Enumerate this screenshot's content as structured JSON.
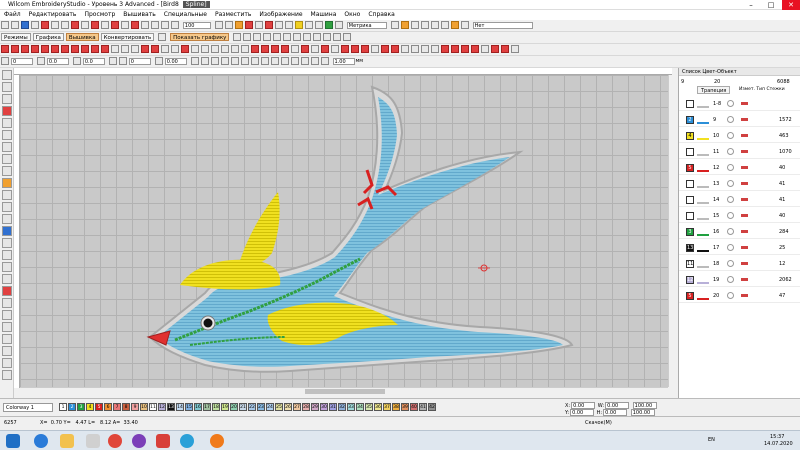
{
  "app": {
    "title": "Wilcom EmbroideryStudio - Уровень 3 Advanced - [Bird8",
    "title_badge": "Spline]"
  },
  "menu": [
    "Файл",
    "Редактировать",
    "Просмотр",
    "Вышивать",
    "Специальные",
    "Разместить",
    "Изображение",
    "Машина",
    "Окно",
    "Справка"
  ],
  "toolbar2": {
    "modes": [
      "Режимы",
      "Графика",
      "Вышивка",
      "Конвертировать"
    ],
    "show_graphics": "Показать графику",
    "zoom": "100",
    "units": "Метрика",
    "none": "Нет"
  },
  "toolbar3": {
    "f1": "0",
    "f2": "0.0",
    "f3": "0.0",
    "f4": "0",
    "f5": "0.00",
    "f6": "1.00",
    "unit": "мм"
  },
  "panel": {
    "title": "Список Цвет-Объект",
    "tab": "Трапеция",
    "hdr_left": "9",
    "hdr_mid": "20",
    "hdr_count": "6088",
    "col_labels": "Измет. Тип   Стежки",
    "rows": [
      {
        "sw": "",
        "num": "1-8",
        "count": "",
        "color": "#ffffff"
      },
      {
        "sw": "2",
        "num": "9",
        "count": "1572",
        "color": "#2b8fd8"
      },
      {
        "sw": "4",
        "num": "10",
        "count": "463",
        "color": "#f2e020"
      },
      {
        "sw": "",
        "num": "11",
        "count": "1070",
        "color": "#ffffff"
      },
      {
        "sw": "5",
        "num": "12",
        "count": "40",
        "color": "#d82020"
      },
      {
        "sw": "",
        "num": "13",
        "count": "41",
        "color": "#ffffff"
      },
      {
        "sw": "",
        "num": "14",
        "count": "41",
        "color": "#ffffff"
      },
      {
        "sw": "",
        "num": "15",
        "count": "40",
        "color": "#ffffff"
      },
      {
        "sw": "3",
        "num": "16",
        "count": "284",
        "color": "#20a040"
      },
      {
        "sw": "13",
        "num": "17",
        "count": "25",
        "color": "#111111"
      },
      {
        "sw": "11",
        "num": "18",
        "count": "12",
        "color": "#ffffff"
      },
      {
        "sw": "12",
        "num": "19",
        "count": "2062",
        "color": "#b8b0d8"
      },
      {
        "sw": "5",
        "num": "20",
        "count": "47",
        "color": "#d82020"
      }
    ]
  },
  "colorbar": {
    "colorway": "Colorway 1",
    "swatches": [
      {
        "n": "1",
        "c": "#ffffff"
      },
      {
        "n": "2",
        "c": "#2b8fd8"
      },
      {
        "n": "3",
        "c": "#20a040"
      },
      {
        "n": "4",
        "c": "#f2e020"
      },
      {
        "n": "5",
        "c": "#d82020"
      },
      {
        "n": "6",
        "c": "#f09030"
      },
      {
        "n": "7",
        "c": "#e87878"
      },
      {
        "n": "8",
        "c": "#c86040"
      },
      {
        "n": "9",
        "c": "#f0a0a0"
      },
      {
        "n": "10",
        "c": "#e8c080"
      },
      {
        "n": "11",
        "c": "#ffffff"
      },
      {
        "n": "12",
        "c": "#b8b0d8"
      },
      {
        "n": "13",
        "c": "#111111"
      },
      {
        "n": "14",
        "c": "#c0d8f0"
      },
      {
        "n": "15",
        "c": "#80b0e0"
      },
      {
        "n": "16",
        "c": "#80c8d0"
      },
      {
        "n": "17",
        "c": "#a0c0a0"
      },
      {
        "n": "18",
        "c": "#c0e0a0"
      },
      {
        "n": "19",
        "c": "#d0e890"
      },
      {
        "n": "20",
        "c": "#90d0b0"
      },
      {
        "n": "21",
        "c": "#c8d8e8"
      },
      {
        "n": "22",
        "c": "#a8c8e8"
      },
      {
        "n": "23",
        "c": "#88b8e0"
      },
      {
        "n": "24",
        "c": "#b0d0f0"
      },
      {
        "n": "25",
        "c": "#e0e0a0"
      },
      {
        "n": "26",
        "c": "#f0e0b0"
      },
      {
        "n": "27",
        "c": "#f0c8a0"
      },
      {
        "n": "28",
        "c": "#e8b0b0"
      },
      {
        "n": "29",
        "c": "#d0a8c8"
      },
      {
        "n": "30",
        "c": "#c0a0d8"
      },
      {
        "n": "31",
        "c": "#a0a0e0"
      },
      {
        "n": "32",
        "c": "#90b0d8"
      },
      {
        "n": "33",
        "c": "#a0d8d8"
      },
      {
        "n": "34",
        "c": "#b0e0c0"
      },
      {
        "n": "35",
        "c": "#d8e8b0"
      },
      {
        "n": "36",
        "c": "#f0e890"
      },
      {
        "n": "37",
        "c": "#f0d060"
      },
      {
        "n": "38",
        "c": "#f0b040"
      },
      {
        "n": "39",
        "c": "#e09060"
      },
      {
        "n": "40",
        "c": "#d07070"
      },
      {
        "n": "41",
        "c": "#b0b0b0"
      },
      {
        "n": "42",
        "c": "#909090"
      }
    ],
    "right": {
      "x_label": "X:",
      "x_val": "0.00",
      "y_label": "Y:",
      "y_val": "0.00",
      "w_label": "W:",
      "w_val": "0.00",
      "h_label": "H:",
      "h_val": "0.00",
      "pct1": "100.00",
      "pct2": "100.00"
    }
  },
  "status": {
    "left": "6257",
    "coords": "X=  0.70 Y=   4.47 L=   8.12 A=  33.40",
    "mode": "Скачок(M)"
  },
  "taskbar": {
    "lang": "EN",
    "time": "15:37",
    "date": "14.07.2020"
  }
}
